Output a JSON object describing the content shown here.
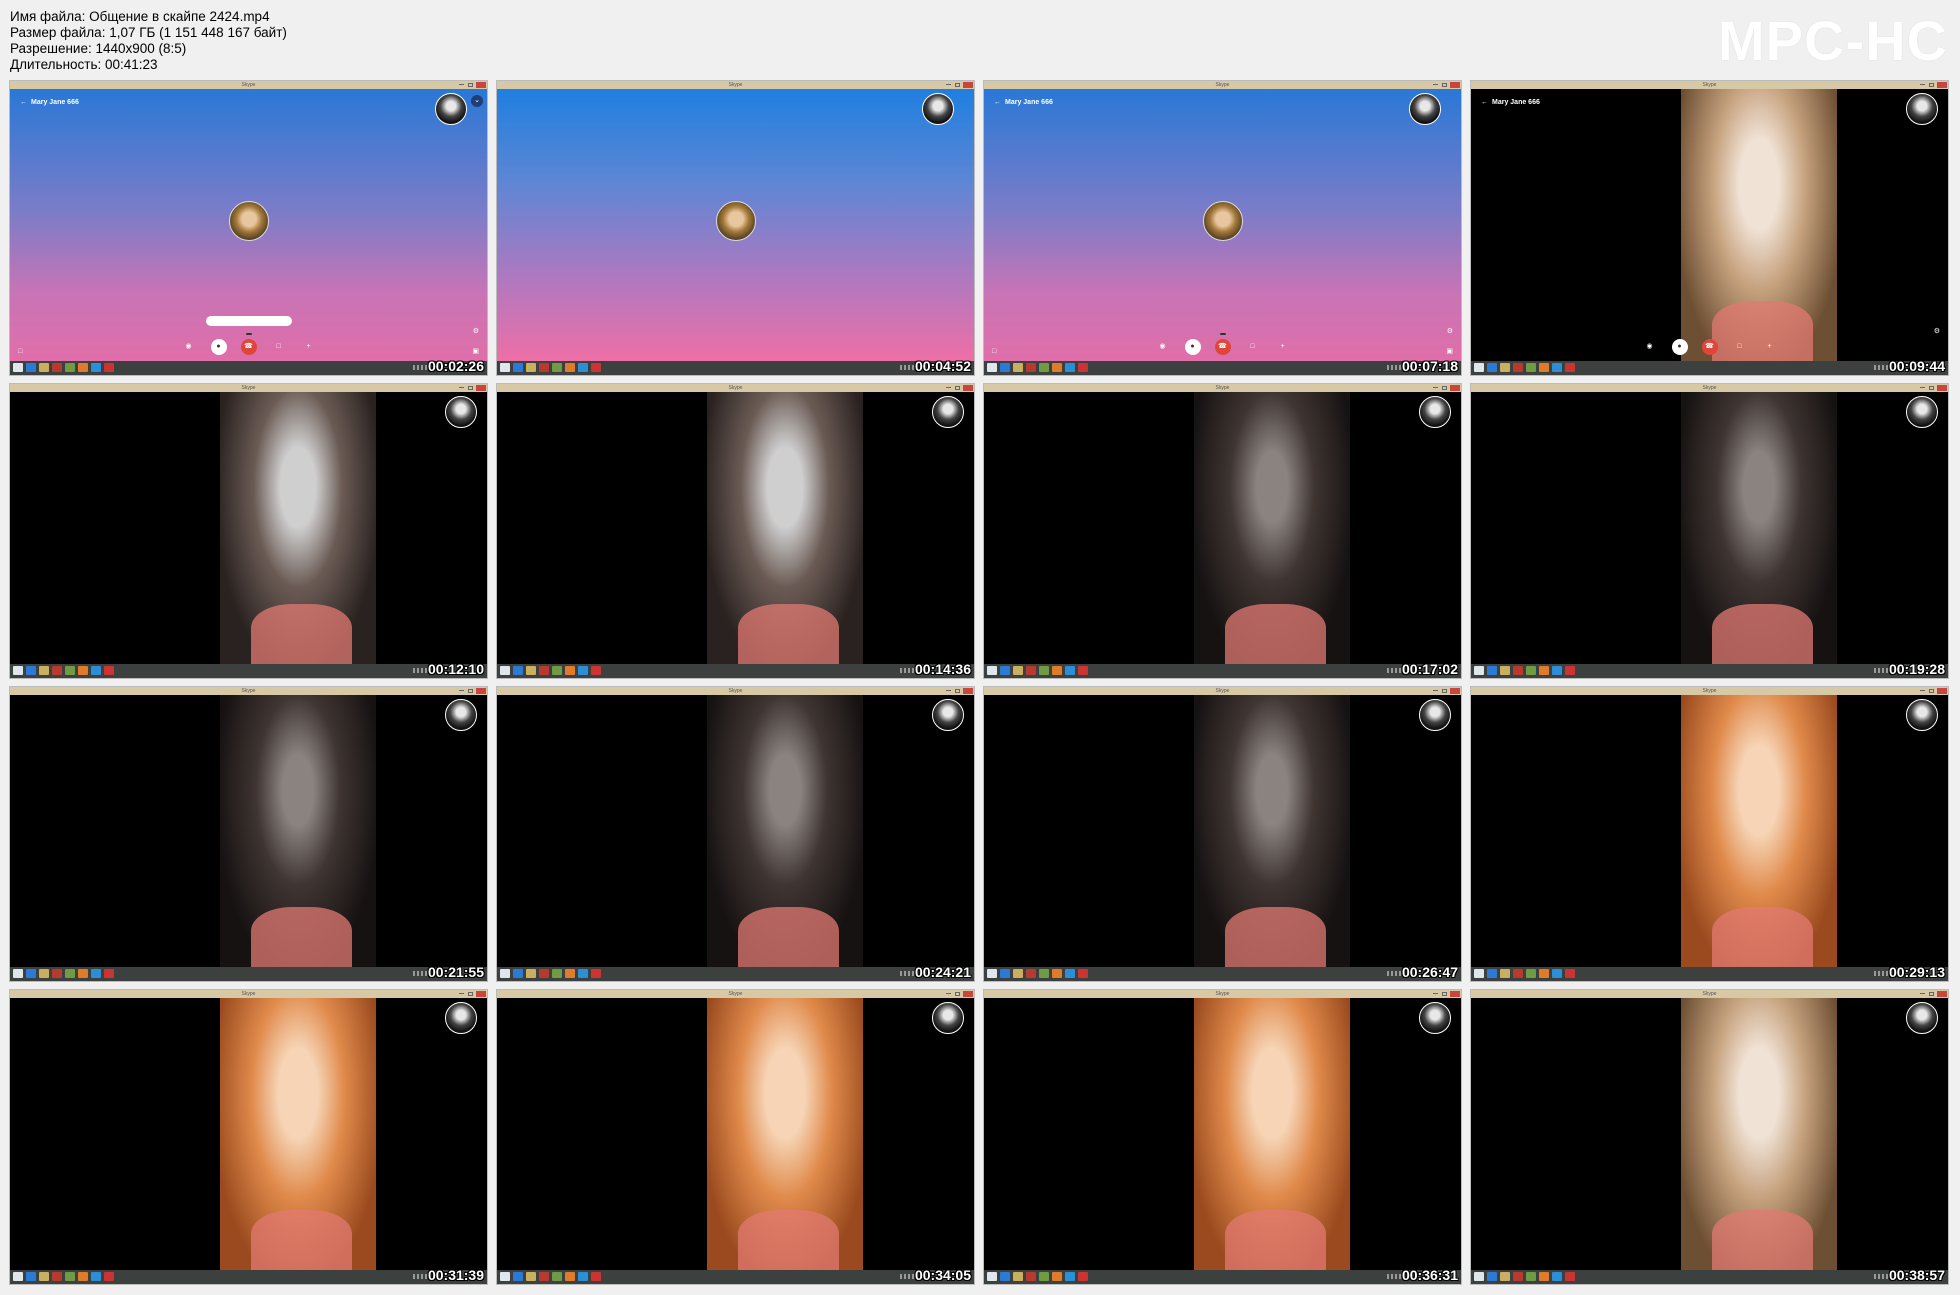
{
  "header": {
    "line1": "Имя файла: Общение в скайпе 2424.mp4",
    "line2": "Размер файла: 1,07 ГБ (1 151 448 167 байт)",
    "line3": "Разрешение: 1440x900 (8:5)",
    "line4": "Длительность: 00:41:23"
  },
  "logo": "MPC-HC",
  "window_title": "Skype",
  "contact_name": "Mary Jane 666",
  "thumbnails": [
    {
      "time": "00:02:26",
      "scene": "call-gradient"
    },
    {
      "time": "00:04:52",
      "scene": "call-gradient-plain"
    },
    {
      "time": "00:07:18",
      "scene": "call-gradient"
    },
    {
      "time": "00:09:44",
      "scene": "video-pale"
    },
    {
      "time": "00:12:10",
      "scene": "video-dim"
    },
    {
      "time": "00:14:36",
      "scene": "video-dim"
    },
    {
      "time": "00:17:02",
      "scene": "video-darker"
    },
    {
      "time": "00:19:28",
      "scene": "video-darker"
    },
    {
      "time": "00:21:55",
      "scene": "video-darker"
    },
    {
      "time": "00:24:21",
      "scene": "video-darker"
    },
    {
      "time": "00:26:47",
      "scene": "video-darker"
    },
    {
      "time": "00:29:13",
      "scene": "video-orange"
    },
    {
      "time": "00:31:39",
      "scene": "video-orange"
    },
    {
      "time": "00:34:05",
      "scene": "video-orange"
    },
    {
      "time": "00:36:31",
      "scene": "video-orange"
    },
    {
      "time": "00:38:57",
      "scene": "video-pale"
    }
  ],
  "taskbar_icon_colors": [
    "#dfe6ec",
    "#2b7bd6",
    "#c9b060",
    "#b8392e",
    "#6f9b45",
    "#e07b2a",
    "#2a8fd6",
    "#c33"
  ]
}
